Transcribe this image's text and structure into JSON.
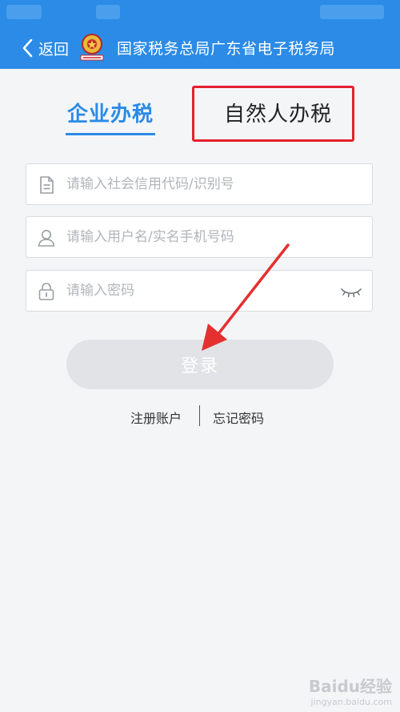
{
  "nav": {
    "back_label": "返回",
    "title": "国家税务总局广东省电子税务局"
  },
  "tabs": {
    "enterprise": "企业办税",
    "person": "自然人办税"
  },
  "form": {
    "credit_code_placeholder": "请输入社会信用代码/识别号",
    "username_placeholder": "请输入用户名/实名手机号码",
    "password_placeholder": "请输入密码"
  },
  "actions": {
    "login_label": "登录",
    "register_label": "注册账户",
    "forgot_label": "忘记密码"
  },
  "watermark": {
    "brand": "Baidu经验",
    "url": "jingyan.baidu.com"
  },
  "colors": {
    "primary": "#2b8be6",
    "highlight_box": "#e5202e",
    "annotation_arrow": "#e53030",
    "login_disabled": "#e1e3e6"
  },
  "icons": {
    "back": "chevron-left-icon",
    "emblem": "tax-emblem-icon",
    "credit_code": "document-icon",
    "username": "user-icon",
    "password": "lock-icon",
    "toggle_password": "eye-closed-icon"
  }
}
